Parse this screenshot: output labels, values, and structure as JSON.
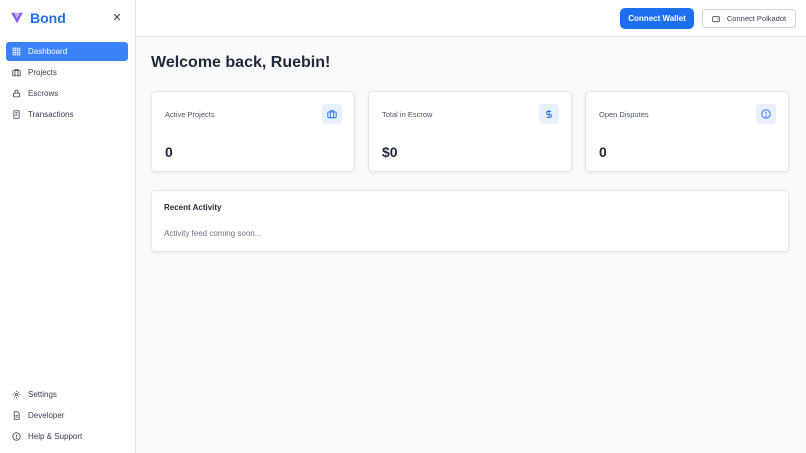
{
  "brand": {
    "name": "Bond",
    "color": "#1d6ff2",
    "logo_color": "#8b5cf6"
  },
  "sidebar": {
    "close_icon": "close-icon",
    "items": [
      {
        "label": "Dashboard",
        "icon": "dashboard-grid-icon",
        "active": true
      },
      {
        "label": "Projects",
        "icon": "briefcase-icon",
        "active": false
      },
      {
        "label": "Escrows",
        "icon": "lock-icon",
        "active": false
      },
      {
        "label": "Transactions",
        "icon": "receipt-icon",
        "active": false
      }
    ],
    "bottom_items": [
      {
        "label": "Settings",
        "icon": "gear-icon"
      },
      {
        "label": "Developer",
        "icon": "document-icon"
      },
      {
        "label": "Help & Support",
        "icon": "help-circle-icon"
      }
    ]
  },
  "header": {
    "connect_wallet": "Connect Wallet",
    "connect_polkadot": "Connect Polkadot"
  },
  "main": {
    "title": "Welcome back, Ruebin!",
    "stats": [
      {
        "label": "Active Projects",
        "value": "0",
        "icon": "briefcase-icon"
      },
      {
        "label": "Total in Escrow",
        "value": "$0",
        "icon": "dollar-icon"
      },
      {
        "label": "Open Disputes",
        "value": "0",
        "icon": "alert-circle-icon"
      }
    ],
    "recent_activity": {
      "title": "Recent Activity",
      "message": "Activity feed coming soon..."
    }
  },
  "colors": {
    "primary": "#1d6ff2",
    "active_nav": "#3b82f6",
    "icon_bg": "#e8f0fd",
    "page_bg": "#f9fafb"
  }
}
